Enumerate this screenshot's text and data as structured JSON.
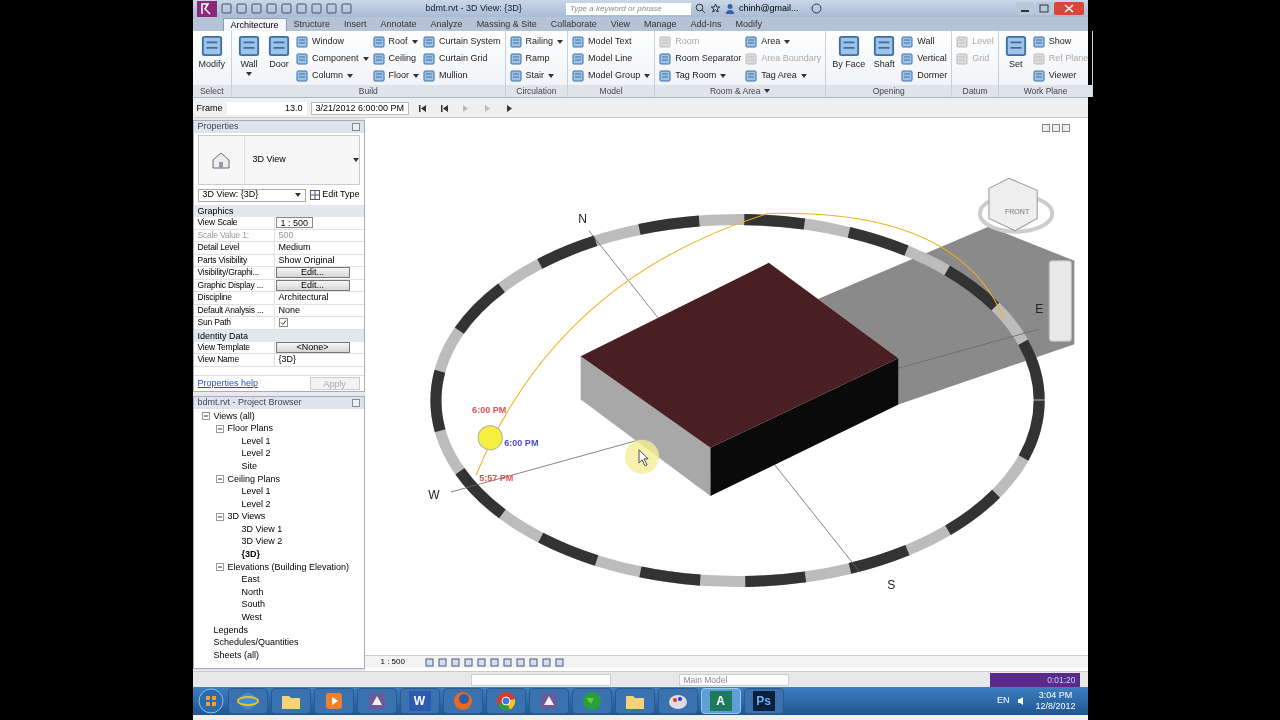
{
  "title_bar": {
    "title": "bdmt.rvt - 3D View: {3D}",
    "search": {
      "placeholder": "Type a keyword or phrase"
    },
    "user": "chinh@gmail..."
  },
  "tabs": [
    {
      "label": "Architecture",
      "selected": true
    },
    {
      "label": "Structure",
      "selected": false
    },
    {
      "label": "Insert",
      "selected": false
    },
    {
      "label": "Annotate",
      "selected": false
    },
    {
      "label": "Analyze",
      "selected": false
    },
    {
      "label": "Massing & Site",
      "selected": false
    },
    {
      "label": "Collaborate",
      "selected": false
    },
    {
      "label": "View",
      "selected": false
    },
    {
      "label": "Manage",
      "selected": false
    },
    {
      "label": "Add-Ins",
      "selected": false
    },
    {
      "label": "Modify",
      "selected": false
    }
  ],
  "ribbon": [
    {
      "label": "Select",
      "dropdown": false,
      "large": [
        {
          "label": "Modify",
          "dropdown": false,
          "disabled": false
        }
      ]
    },
    {
      "label": "Build",
      "dropdown": false,
      "large": [
        {
          "label": "Wall",
          "dropdown": true,
          "disabled": false
        },
        {
          "label": "Door",
          "dropdown": false,
          "disabled": false
        }
      ],
      "columns": [
        [
          {
            "label": "Window",
            "dropdown": false,
            "disabled": false
          },
          {
            "label": "Component",
            "dropdown": true,
            "disabled": false
          },
          {
            "label": "Column",
            "dropdown": true,
            "disabled": false
          }
        ],
        [
          {
            "label": "Roof",
            "dropdown": true,
            "disabled": false
          },
          {
            "label": "Ceiling",
            "dropdown": false,
            "disabled": false
          },
          {
            "label": "Floor",
            "dropdown": true,
            "disabled": false
          }
        ],
        [
          {
            "label": "Curtain System",
            "dropdown": false,
            "disabled": false
          },
          {
            "label": "Curtain Grid",
            "dropdown": false,
            "disabled": false
          },
          {
            "label": "Mullion",
            "dropdown": false,
            "disabled": false
          }
        ]
      ]
    },
    {
      "label": "Circulation",
      "dropdown": false,
      "columns": [
        [
          {
            "label": "Railing",
            "dropdown": true,
            "disabled": false
          },
          {
            "label": "Ramp",
            "dropdown": false,
            "disabled": false
          },
          {
            "label": "Stair",
            "dropdown": true,
            "disabled": false
          }
        ]
      ]
    },
    {
      "label": "Model",
      "dropdown": false,
      "columns": [
        [
          {
            "label": "Model Text",
            "dropdown": false,
            "disabled": false
          },
          {
            "label": "Model Line",
            "dropdown": false,
            "disabled": false
          },
          {
            "label": "Model Group",
            "dropdown": true,
            "disabled": false
          }
        ]
      ]
    },
    {
      "label": "Room & Area",
      "dropdown": true,
      "columns": [
        [
          {
            "label": "Room",
            "dropdown": false,
            "disabled": true
          },
          {
            "label": "Room Separator",
            "dropdown": false,
            "disabled": false
          },
          {
            "label": "Tag Room",
            "dropdown": true,
            "disabled": false
          }
        ],
        [
          {
            "label": "Area",
            "dropdown": true,
            "disabled": false
          },
          {
            "label": "Area Boundary",
            "dropdown": false,
            "disabled": true
          },
          {
            "label": "Tag Area",
            "dropdown": true,
            "disabled": false
          }
        ]
      ]
    },
    {
      "label": "Opening",
      "dropdown": false,
      "large": [
        {
          "label": "By Face",
          "dropdown": false,
          "disabled": false
        },
        {
          "label": "Shaft",
          "dropdown": false,
          "disabled": false
        }
      ],
      "columns": [
        [
          {
            "label": "Wall",
            "dropdown": false,
            "disabled": false
          },
          {
            "label": "Vertical",
            "dropdown": false,
            "disabled": false
          },
          {
            "label": "Dormer",
            "dropdown": false,
            "disabled": false
          }
        ]
      ]
    },
    {
      "label": "Datum",
      "dropdown": false,
      "columns": [
        [
          {
            "label": "Level",
            "dropdown": false,
            "disabled": true
          },
          {
            "label": "Grid",
            "dropdown": false,
            "disabled": true
          }
        ]
      ]
    },
    {
      "label": "Work Plane",
      "dropdown": false,
      "large": [
        {
          "label": "Set",
          "dropdown": false,
          "disabled": false
        }
      ],
      "columns": [
        [
          {
            "label": "Show",
            "dropdown": false,
            "disabled": false
          },
          {
            "label": "Ref Plane",
            "dropdown": false,
            "disabled": true
          },
          {
            "label": "Viewer",
            "dropdown": false,
            "disabled": false
          }
        ]
      ]
    }
  ],
  "options_bar": {
    "label": "Frame",
    "frame": "13.0",
    "date": "3/21/2012 6:00:00 PM"
  },
  "properties": {
    "title": "Properties",
    "type": "3D View",
    "instance": "3D View: {3D}",
    "edit_type": "Edit Type",
    "groups": [
      {
        "label": "Graphics",
        "rows": [
          {
            "kind": "field",
            "label": "View Scale",
            "value": "1 : 500",
            "disabled": false
          },
          {
            "kind": "text",
            "label": "Scale Value  1:",
            "value": "500",
            "disabled": true
          },
          {
            "kind": "text",
            "label": "Detail Level",
            "value": "Medium",
            "disabled": false
          },
          {
            "kind": "text",
            "label": "Parts Visibility",
            "value": "Show Original",
            "disabled": false
          },
          {
            "kind": "button",
            "label": "Visibility/Graphi...",
            "value": "Edit...",
            "disabled": false
          },
          {
            "kind": "button",
            "label": "Graphic Display ...",
            "value": "Edit...",
            "disabled": false
          },
          {
            "kind": "text",
            "label": "Discipline",
            "value": "Architectural",
            "disabled": false
          },
          {
            "kind": "text",
            "label": "Default Analysis ...",
            "value": "None",
            "disabled": false
          },
          {
            "kind": "checkbox",
            "label": "Sun Path",
            "checked": true,
            "disabled": false
          }
        ]
      },
      {
        "label": "Identity Data",
        "rows": [
          {
            "kind": "button",
            "label": "View Template",
            "value": "<None>",
            "disabled": false
          },
          {
            "kind": "text",
            "label": "View Name",
            "value": "{3D}",
            "disabled": false
          }
        ]
      }
    ],
    "help": "Properties help",
    "apply": "Apply"
  },
  "browser": {
    "title": "bdmt.rvt - Project Browser",
    "tree": [
      {
        "label": "Views (all)",
        "expanded": true,
        "selected": false,
        "children": [
          {
            "label": "Floor Plans",
            "expanded": true,
            "selected": false,
            "children": [
              {
                "label": "Level 1",
                "selected": false
              },
              {
                "label": "Level 2",
                "selected": false
              },
              {
                "label": "Site",
                "selected": false
              }
            ]
          },
          {
            "label": "Ceiling Plans",
            "expanded": true,
            "selected": false,
            "children": [
              {
                "label": "Level 1",
                "selected": false
              },
              {
                "label": "Level 2",
                "selected": false
              }
            ]
          },
          {
            "label": "3D Views",
            "expanded": true,
            "selected": false,
            "children": [
              {
                "label": "3D View 1",
                "selected": false
              },
              {
                "label": "3D View 2",
                "selected": false
              },
              {
                "label": "{3D}",
                "selected": true
              }
            ]
          },
          {
            "label": "Elevations (Building Elevation)",
            "expanded": true,
            "selected": false,
            "children": [
              {
                "label": "East",
                "selected": false
              },
              {
                "label": "North",
                "selected": false
              },
              {
                "label": "South",
                "selected": false
              },
              {
                "label": "West",
                "selected": false
              }
            ]
          }
        ]
      },
      {
        "label": "Legends",
        "selected": false
      },
      {
        "label": "Schedules/Quantities",
        "selected": false
      },
      {
        "label": "Sheets (all)",
        "selected": false
      }
    ]
  },
  "viewport": {
    "compass": [
      {
        "kind": "n",
        "label": "N"
      },
      {
        "kind": "s",
        "label": "S"
      },
      {
        "kind": "w",
        "label": "W"
      },
      {
        "kind": "e",
        "label": "E"
      }
    ],
    "times": [
      {
        "kind": "upper",
        "label": "6:00 PM",
        "color": "#e05050"
      },
      {
        "kind": "sun",
        "label": "6:00 PM",
        "color": "#4a4ad0"
      },
      {
        "kind": "lower",
        "label": "5:57 PM",
        "color": "#e05050"
      }
    ],
    "viewcube": "FRONT",
    "scale": "1 : 500"
  },
  "status_bar": {
    "model": "Main Model",
    "recorder": "0:01:20"
  },
  "taskbar": {
    "apps": [
      {
        "kind": "ie",
        "active": false
      },
      {
        "kind": "folder",
        "active": false
      },
      {
        "kind": "media",
        "active": false
      },
      {
        "kind": "app",
        "active": false
      },
      {
        "kind": "word",
        "glyph": "W",
        "active": false
      },
      {
        "kind": "firefox",
        "active": false
      },
      {
        "kind": "chrome",
        "active": false
      },
      {
        "kind": "app",
        "active": false
      },
      {
        "kind": "globe",
        "active": false
      },
      {
        "kind": "folder",
        "active": false
      },
      {
        "kind": "paint",
        "active": false
      },
      {
        "kind": "letter",
        "glyph": "A",
        "active": true
      },
      {
        "kind": "ps",
        "glyph": "Ps",
        "active": false
      }
    ],
    "language": "EN",
    "time": "3:04 PM",
    "date": "12/8/2012"
  }
}
